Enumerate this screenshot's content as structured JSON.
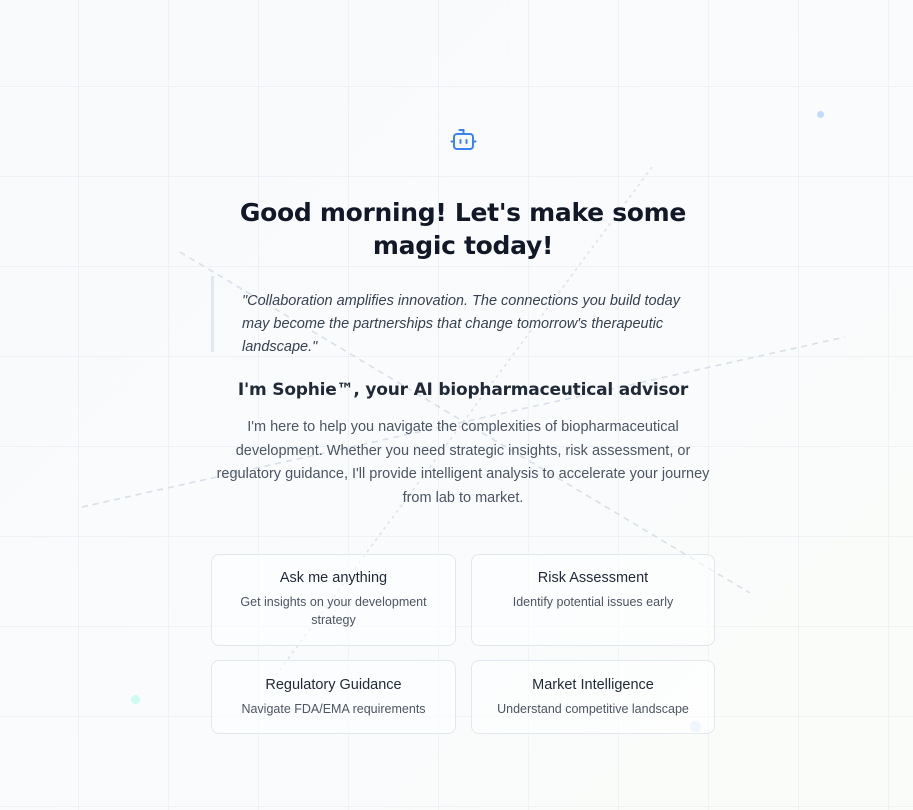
{
  "greeting": "Good morning! Let's make some magic today!",
  "quote": "\"Collaboration amplifies innovation. The connections you build today may become the partnerships that change tomorrow's therapeutic landscape.\"",
  "intro": {
    "title": "I'm Sophie™, your AI biopharmaceutical advisor",
    "text": "I'm here to help you navigate the complexities of biopharmaceutical development. Whether you need strategic insights, risk assessment, or regulatory guidance, I'll provide intelligent analysis to accelerate your journey from lab to market."
  },
  "cards": [
    {
      "title": "Ask me anything",
      "description": "Get insights on your development strategy"
    },
    {
      "title": "Risk Assessment",
      "description": "Identify potential issues early"
    },
    {
      "title": "Regulatory Guidance",
      "description": "Navigate FDA/EMA requirements"
    },
    {
      "title": "Market Intelligence",
      "description": "Understand competitive landscape"
    }
  ],
  "icons": {
    "assistant": "robot-icon"
  },
  "colors": {
    "accent": "#3b82f6",
    "heading": "#111827",
    "body_text": "#4b5563",
    "card_border": "#e2e8f0"
  }
}
